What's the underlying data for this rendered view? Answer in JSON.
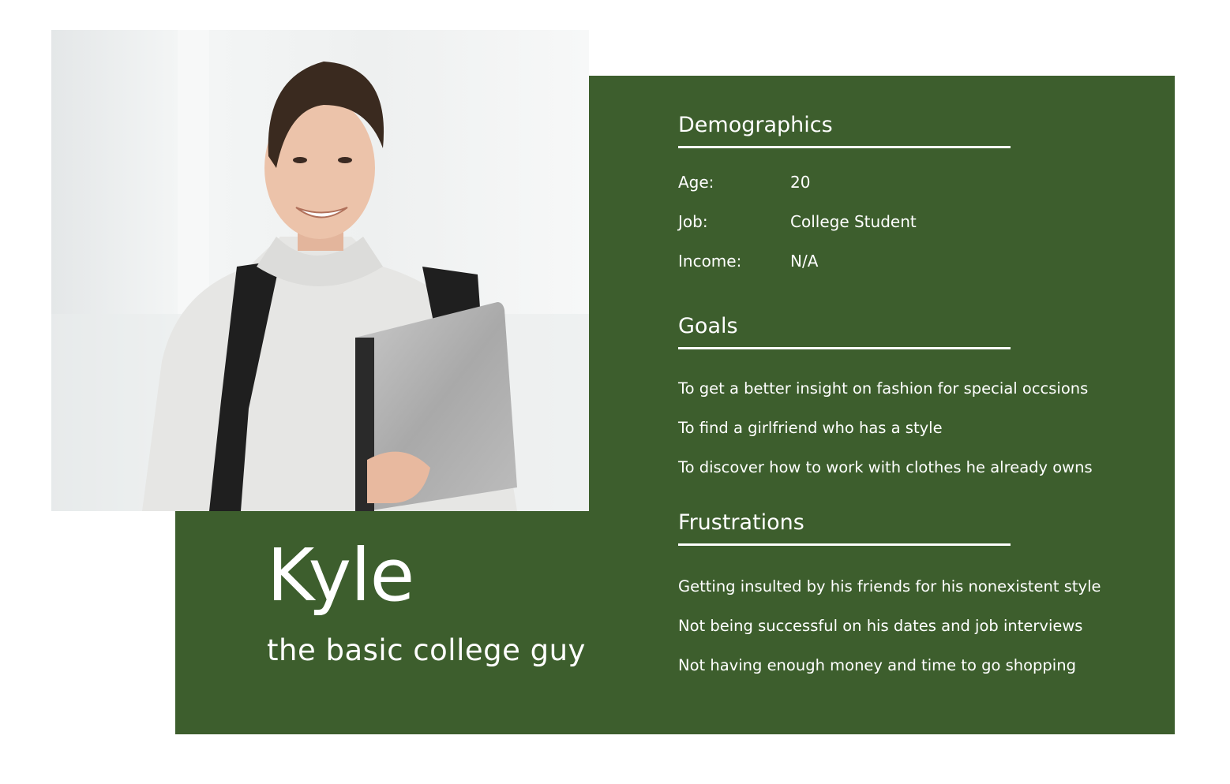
{
  "persona": {
    "name": "Kyle",
    "tagline": "the basic college guy"
  },
  "demographics": {
    "heading": "Demographics",
    "rows": [
      {
        "label": "Age:",
        "value": "20"
      },
      {
        "label": "Job:",
        "value": "College Student"
      },
      {
        "label": "Income:",
        "value": "N/A"
      }
    ]
  },
  "goals": {
    "heading": "Goals",
    "items": [
      "To get a better insight on fashion for special occsions",
      "To find a girlfriend who has a style",
      "To discover how to work with clothes he already owns"
    ]
  },
  "frustrations": {
    "heading": "Frustrations",
    "items": [
      "Getting insulted by his friends for his nonexistent style",
      "Not being successful on his dates and job interviews",
      "Not having enough money and time to go shopping"
    ]
  },
  "colors": {
    "card_green": "#3d5e2d",
    "text": "#ffffff"
  }
}
